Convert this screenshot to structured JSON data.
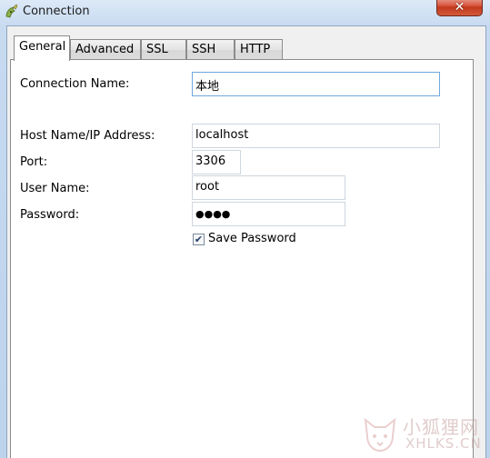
{
  "window": {
    "title": "Connection",
    "close_symbol": "✕",
    "app_icon": "navicat-dolphin-icon"
  },
  "tabs": [
    {
      "label": "General",
      "active": true
    },
    {
      "label": "Advanced",
      "active": false
    },
    {
      "label": "SSL",
      "active": false
    },
    {
      "label": "SSH",
      "active": false
    },
    {
      "label": "HTTP",
      "active": false
    }
  ],
  "form": {
    "connection_name_label": "Connection Name:",
    "connection_name_value": "本地",
    "host_label": "Host Name/IP Address:",
    "host_value": "localhost",
    "port_label": "Port:",
    "port_value": "3306",
    "user_label": "User Name:",
    "user_value": "root",
    "password_label": "Password:",
    "password_value": "●●●●",
    "save_password_label": "Save Password",
    "save_password_checked": true,
    "check_mark": "✔"
  },
  "watermark": {
    "cn": "小狐狸网",
    "en": "XHLKS.CN",
    "icon": "fox-logo-icon"
  }
}
